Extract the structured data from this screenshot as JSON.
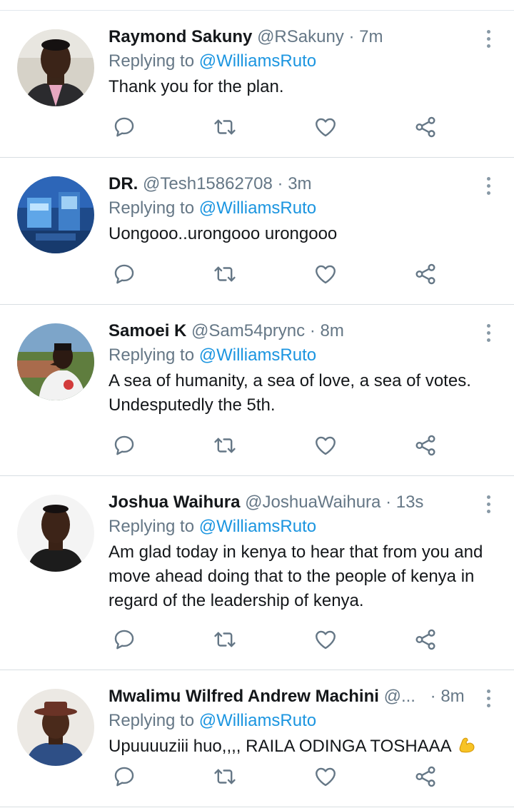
{
  "colors": {
    "link": "#1b95e0",
    "muted": "#657786",
    "text": "#14171a",
    "divider": "#d8dee2"
  },
  "icons": {
    "reply": "reply-icon",
    "retweet": "retweet-icon",
    "like": "heart-icon",
    "share": "share-icon",
    "more": "more-vertical-icon"
  },
  "tweets": [
    {
      "name": "Raymond Sakuny",
      "handle": "@RSakuny",
      "time": "· 7m",
      "replying_label": "Replying to",
      "mention": "@WilliamsRuto",
      "text": "Thank you for the plan."
    },
    {
      "name": "DR.",
      "handle": "@Tesh15862708",
      "time": "· 3m",
      "replying_label": "Replying to",
      "mention": "@WilliamsRuto",
      "text": "Uongooo..urongooo urongooo"
    },
    {
      "name": "Samoei K",
      "handle": "@Sam54prync",
      "time": "· 8m",
      "replying_label": "Replying to",
      "mention": "@WilliamsRuto",
      "text": "A sea of humanity, a sea of love, a sea of votes. Undesputedly the 5th."
    },
    {
      "name": "Joshua Waihura",
      "handle": "@JoshuaWaihura",
      "time": "· 13s",
      "replying_label": "Replying to",
      "mention": "@WilliamsRuto",
      "text": "Am glad today in kenya to hear that from you and move ahead doing that to the people of kenya in regard of the leadership of kenya."
    },
    {
      "name": "Mwalimu Wilfred Andrew Machini",
      "handle": "@...",
      "time": "· 8m",
      "replying_label": "Replying to",
      "mention": "@WilliamsRuto",
      "text": "Upuuuuziii huo,,,, RAILA ODINGA TOSHAAA",
      "emoji": "flexed-biceps-emoji"
    }
  ]
}
